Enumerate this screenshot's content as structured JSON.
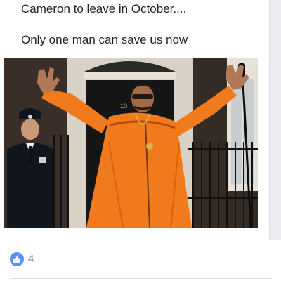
{
  "post": {
    "lines": [
      "Cameron to leave in October....",
      "Only one man can save us now"
    ],
    "reactions": {
      "icon": "thumbs-up-icon",
      "count": "4",
      "color": "#5890ff"
    }
  },
  "colors": {
    "page_background": "#e9ebee",
    "card_background": "#ffffff",
    "text": "#1d2129",
    "reaction_count_text": "#7f7f7f",
    "tracksuit_orange": "#f07a1c"
  }
}
